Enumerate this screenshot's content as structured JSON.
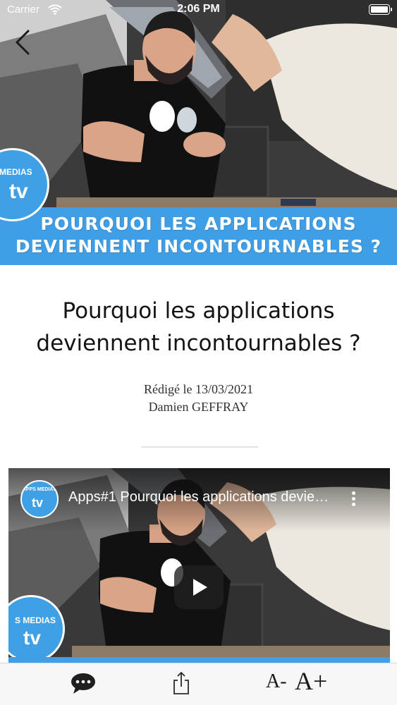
{
  "status_bar": {
    "carrier": "Carrier",
    "time": "2:06 PM"
  },
  "hero": {
    "banner_line1": "POURQUOI LES APPLICATIONS",
    "banner_line2": "DEVIENNENT INCONTOURNABLES ?",
    "logo_word": "MEDIAS",
    "logo_tv": "tv",
    "back_icon": "chevron-left-icon"
  },
  "article": {
    "title_line1": "Pourquoi les applications",
    "title_line2": "deviennent incontournables ?",
    "date_line": "Rédigé le 13/03/2021",
    "author": "Damien GEFFRAY"
  },
  "video": {
    "title": "Apps#1 Pourquoi les applications deviennent incontournables ?",
    "channel_name": "APPS MEDIAS",
    "channel_tv": "tv",
    "logo_word": "S MEDIAS",
    "logo_tv": "tv"
  },
  "toolbar": {
    "comments_icon": "speech-bubble-icon",
    "share_icon": "share-icon",
    "font_smaller": "A-",
    "font_larger": "A+"
  },
  "colors": {
    "banner_blue": "#3f9ee6",
    "toolbar_bg": "#f7f7f8"
  }
}
